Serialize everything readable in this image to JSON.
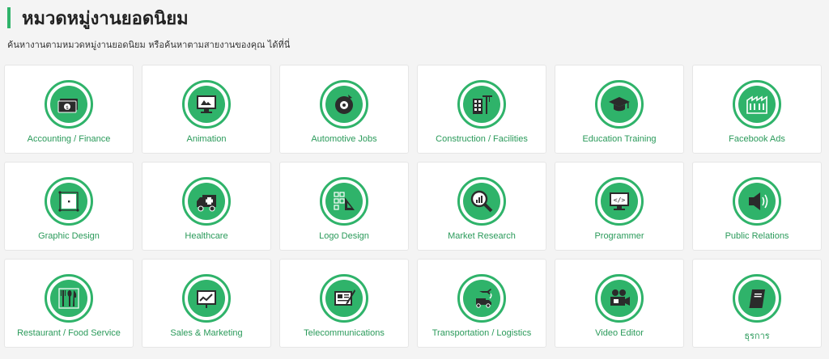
{
  "header": {
    "title": "หมวดหมู่งานยอดนิยม",
    "subtitle": "ค้นหางานตามหมวดหมู่งานยอดนิยม หรือค้นหาตามสายงานของคุณ ได้ที่นี่"
  },
  "colors": {
    "accent": "#2fb36a",
    "label": "#2a9a5a",
    "icon_dark": "#2b2b2b"
  },
  "categories": [
    {
      "label": "Accounting / Finance",
      "icon": "money-icon"
    },
    {
      "label": "Animation",
      "icon": "monitor-animation-icon"
    },
    {
      "label": "Automotive Jobs",
      "icon": "wheel-icon"
    },
    {
      "label": "Construction / Facilities",
      "icon": "building-crane-icon"
    },
    {
      "label": "Education Training",
      "icon": "graduation-cap-icon"
    },
    {
      "label": "Facebook Ads",
      "icon": "factory-icon"
    },
    {
      "label": "Graphic Design",
      "icon": "design-tools-icon"
    },
    {
      "label": "Healthcare",
      "icon": "ambulance-icon"
    },
    {
      "label": "Logo Design",
      "icon": "logo-design-icon"
    },
    {
      "label": "Market Research",
      "icon": "magnifier-chart-icon"
    },
    {
      "label": "Programmer",
      "icon": "code-monitor-icon"
    },
    {
      "label": "Public Relations",
      "icon": "speaker-icon"
    },
    {
      "label": "Restaurant / Food Service",
      "icon": "cutlery-icon"
    },
    {
      "label": "Sales & Marketing",
      "icon": "sales-chart-icon"
    },
    {
      "label": "Telecommunications",
      "icon": "document-pen-icon"
    },
    {
      "label": "Transportation / Logistics",
      "icon": "truck-plane-icon"
    },
    {
      "label": "Video Editor",
      "icon": "video-camera-icon"
    },
    {
      "label": "ธุรการ",
      "icon": "book-icon"
    }
  ]
}
